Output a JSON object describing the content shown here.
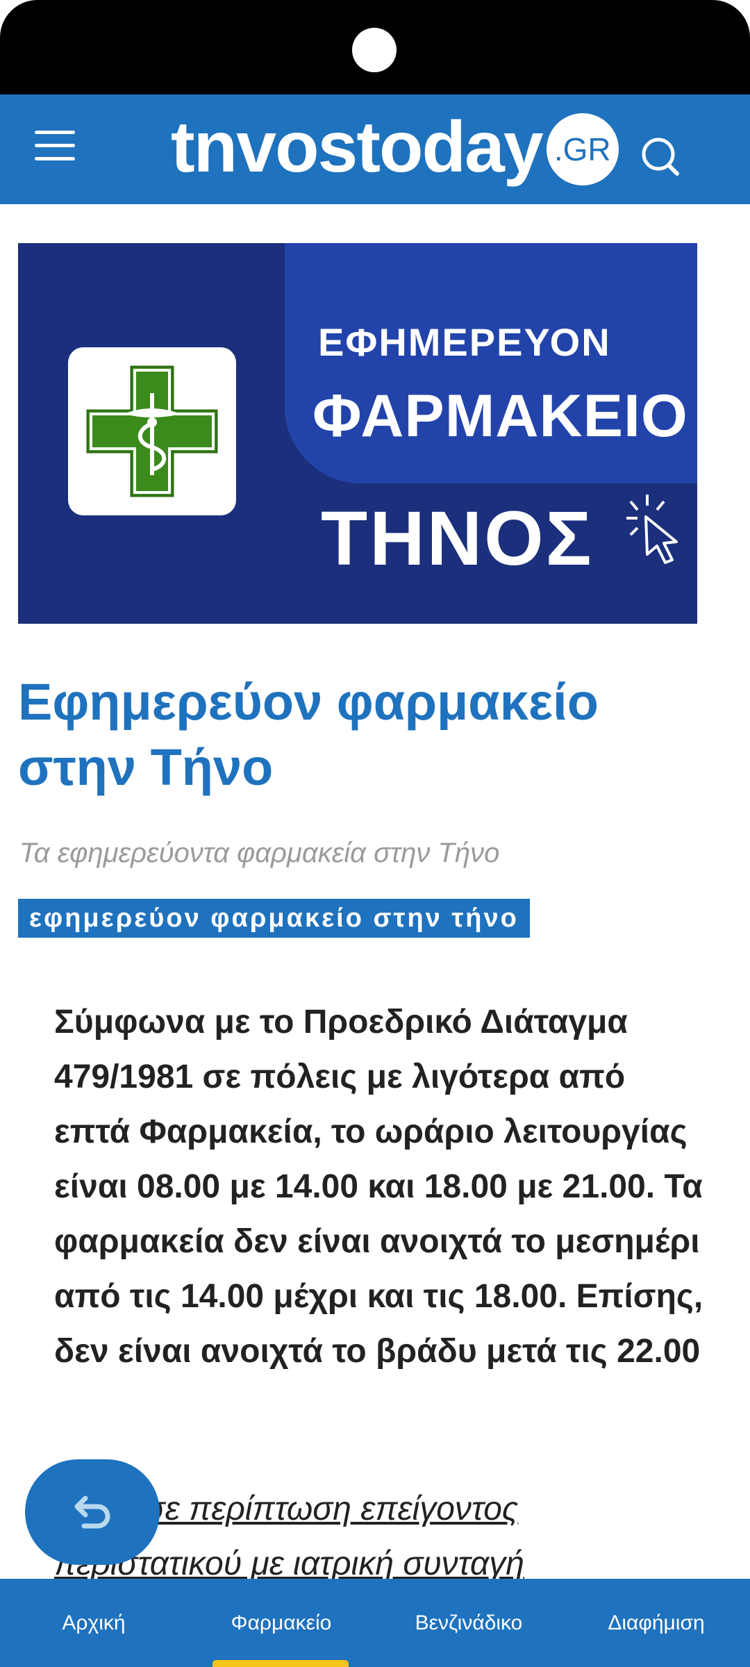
{
  "brand": {
    "name": "tnvostoday",
    "badge": ".GR"
  },
  "hero": {
    "line1": "ΕΦΗΜΕΡΕΥΟΝ",
    "line2": "ΦΑΡΜΑΚΕΙΟ",
    "line3": "ΤΗΝΟΣ",
    "icon": "pharmacy-cross-icon"
  },
  "article": {
    "title": "Εφημερεύον φαρμακείο στην Τήνο",
    "subtitle": "Τα εφημερεύοντα φαρμακεία στην Τήνο",
    "tag": "εφημερεύον φαρμακείο στην τήνο",
    "body": "Σύμφωνα με το Προεδρικό Διάταγμα 479/1981 σε πόλεις με λιγότερα από επτά Φαρμακεία, το ωράριο λειτουργίας είναι 08.00 με 14.00 και 18.00 με 21.00. Τα φαρμακεία δεν είναι ανοιχτά το μεσημέρι από τις 14.00 μέχρι και τις 18.00. Επίσης, δεν είναι ανοιχτά το βράδυ μετά τις 22.00",
    "link_partial": "Μόνο σε περίπτωση επείγοντος περιστατικού με ιατρική συνταγή"
  },
  "bottom_nav": {
    "items": [
      "Αρχική",
      "Φαρμακείο",
      "Βενζινάδικο",
      "Διαφήμιση"
    ],
    "active": "Φαρμακείο"
  },
  "colors": {
    "primary": "#1f72bd",
    "hero_dark": "#1b2f7c",
    "hero_panel": "#2244aa",
    "pharmacy_green": "#3a8a1c",
    "nav_indicator": "#f6c51a"
  },
  "icons": {
    "menu": "hamburger-menu-icon",
    "search": "search-icon",
    "back": "back-arrow-icon",
    "cursor": "click-cursor-icon"
  }
}
